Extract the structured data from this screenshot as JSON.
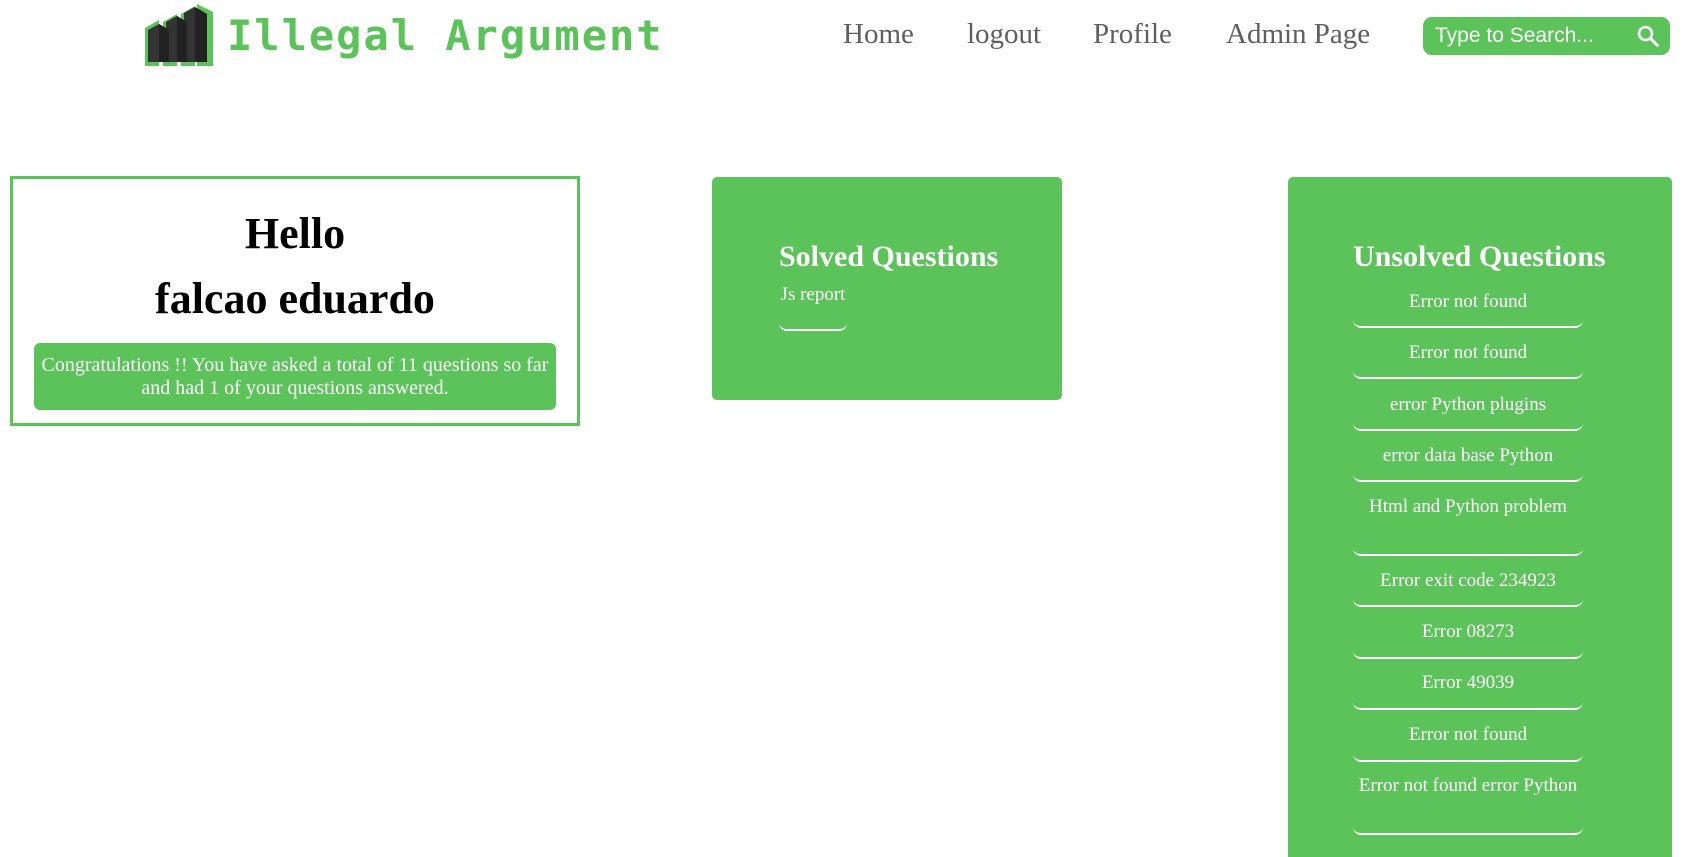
{
  "brand": {
    "name": "Illegal Argument",
    "logo_icon": "stacked-blocks-logo-icon",
    "accent": "#5bc35a"
  },
  "nav": {
    "items": [
      {
        "label": "Home"
      },
      {
        "label": "logout"
      },
      {
        "label": "Profile"
      },
      {
        "label": "Admin Page"
      }
    ]
  },
  "search": {
    "placeholder": "Type to Search...",
    "icon": "search-icon"
  },
  "greeting": {
    "title": "Hello",
    "name": "falcao eduardo",
    "message": "Congratulations !! You have asked a total of 11 questions so far and had 1 of your questions answered."
  },
  "solved": {
    "title": "Solved Questions",
    "items": [
      {
        "label": "Js report"
      }
    ]
  },
  "unsolved": {
    "title": "Unsolved Questions",
    "items": [
      {
        "label": "Error not found"
      },
      {
        "label": "Error not found"
      },
      {
        "label": "error Python plugins"
      },
      {
        "label": "error data base Python"
      },
      {
        "label": "Html and Python problem"
      },
      {
        "label": "Error exit code 234923"
      },
      {
        "label": "Error 08273"
      },
      {
        "label": "Error 49039"
      },
      {
        "label": "Error not found"
      },
      {
        "label": "Error not found error Python"
      }
    ]
  }
}
